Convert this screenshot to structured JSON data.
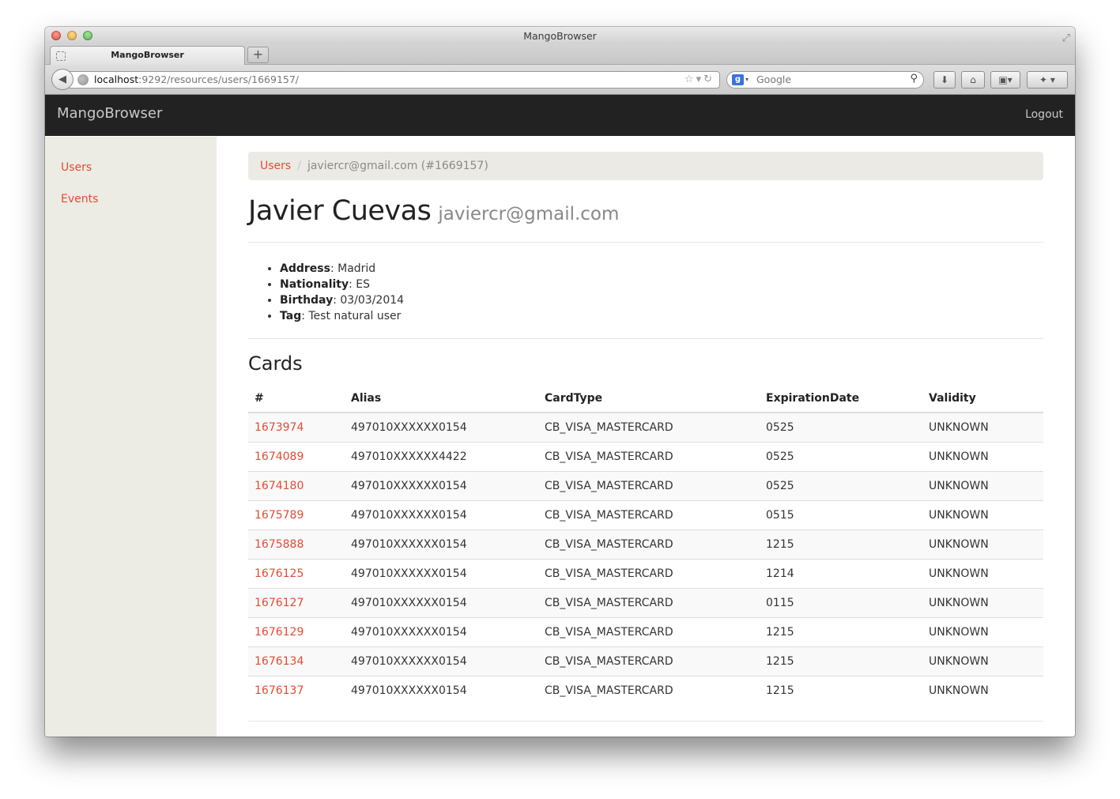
{
  "window": {
    "title": "MangoBrowser"
  },
  "tab": {
    "label": "MangoBrowser",
    "new_tab_label": "+"
  },
  "address_bar": {
    "host": "localhost",
    "path": ":9292/resources/users/1669157/"
  },
  "search_bar": {
    "placeholder": "Google"
  },
  "app": {
    "brand": "MangoBrowser",
    "logout_label": "Logout"
  },
  "sidebar": {
    "items": [
      {
        "label": "Users"
      },
      {
        "label": "Events"
      }
    ]
  },
  "breadcrumb": {
    "root": "Users",
    "separator": "/",
    "current": "javiercr@gmail.com (#1669157)"
  },
  "user": {
    "name": "Javier Cuevas",
    "email": "javiercr@gmail.com",
    "details": [
      {
        "label": "Address",
        "value": ": Madrid"
      },
      {
        "label": "Nationality",
        "value": ": ES"
      },
      {
        "label": "Birthday",
        "value": ": 03/03/2014"
      },
      {
        "label": "Tag",
        "value": ": Test natural user"
      }
    ]
  },
  "cards": {
    "title": "Cards",
    "columns": [
      "#",
      "Alias",
      "CardType",
      "ExpirationDate",
      "Validity"
    ],
    "rows": [
      {
        "id": "1673974",
        "alias": "497010XXXXXX0154",
        "type": "CB_VISA_MASTERCARD",
        "exp": "0525",
        "validity": "UNKNOWN"
      },
      {
        "id": "1674089",
        "alias": "497010XXXXXX4422",
        "type": "CB_VISA_MASTERCARD",
        "exp": "0525",
        "validity": "UNKNOWN"
      },
      {
        "id": "1674180",
        "alias": "497010XXXXXX0154",
        "type": "CB_VISA_MASTERCARD",
        "exp": "0525",
        "validity": "UNKNOWN"
      },
      {
        "id": "1675789",
        "alias": "497010XXXXXX0154",
        "type": "CB_VISA_MASTERCARD",
        "exp": "0515",
        "validity": "UNKNOWN"
      },
      {
        "id": "1675888",
        "alias": "497010XXXXXX0154",
        "type": "CB_VISA_MASTERCARD",
        "exp": "1215",
        "validity": "UNKNOWN"
      },
      {
        "id": "1676125",
        "alias": "497010XXXXXX0154",
        "type": "CB_VISA_MASTERCARD",
        "exp": "1214",
        "validity": "UNKNOWN"
      },
      {
        "id": "1676127",
        "alias": "497010XXXXXX0154",
        "type": "CB_VISA_MASTERCARD",
        "exp": "0115",
        "validity": "UNKNOWN"
      },
      {
        "id": "1676129",
        "alias": "497010XXXXXX0154",
        "type": "CB_VISA_MASTERCARD",
        "exp": "1215",
        "validity": "UNKNOWN"
      },
      {
        "id": "1676134",
        "alias": "497010XXXXXX0154",
        "type": "CB_VISA_MASTERCARD",
        "exp": "1215",
        "validity": "UNKNOWN"
      },
      {
        "id": "1676137",
        "alias": "497010XXXXXX0154",
        "type": "CB_VISA_MASTERCARD",
        "exp": "1215",
        "validity": "UNKNOWN"
      }
    ]
  },
  "colors": {
    "link": "#e24b33",
    "navbar_bg": "#222222",
    "sidebar_bg": "#ecebe4",
    "breadcrumb_bg": "#eceae5"
  },
  "icons": {
    "back": "back-arrow-icon",
    "globe": "globe-icon",
    "bookmark": "star-icon",
    "reload": "reload-icon",
    "search": "search-icon",
    "download": "download-icon",
    "home": "home-icon",
    "bookmarks_menu": "bookmarks-icon",
    "extensions": "puzzle-icon"
  }
}
